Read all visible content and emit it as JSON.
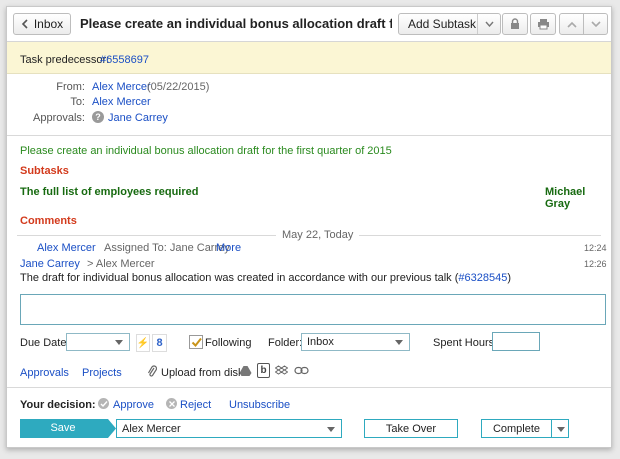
{
  "toolbar": {
    "back_label": "Inbox",
    "title": "Please create an individual bonus allocation draft for the fi",
    "add_subtask_label": "Add Subtask"
  },
  "predecessor": {
    "label": "Task predecessor:",
    "link": "#6558697"
  },
  "meta": {
    "from_label": "From:",
    "from_name": "Alex Mercer",
    "from_date": "(05/22/2015)",
    "to_label": "To:",
    "to_name": "Alex Mercer",
    "approvals_label": "Approvals:",
    "approvals_name": "Jane Carrey"
  },
  "description": "Please create an individual bonus allocation draft for the first quarter of 2015",
  "subtasks": {
    "heading": "Subtasks",
    "items": [
      {
        "name": "The full list of employees required",
        "assignee": "Michael Gray"
      }
    ]
  },
  "comments": {
    "heading": "Comments",
    "date_divider": "May 22, Today",
    "entries": [
      {
        "author": "Alex Mercer",
        "text": "Assigned To: Jane Carrey",
        "more": "More",
        "time": "12:24"
      },
      {
        "author": "Jane Carrey",
        "text": "> Alex Mercer",
        "time": "12:26",
        "body": "The draft for individual bonus allocation was created in accordance with our previous talk (",
        "body_link": "#6328545",
        "body_end": ")"
      }
    ]
  },
  "form": {
    "due_date_label": "Due Date:",
    "calendar_icon_text": "8",
    "following_label": "Following",
    "following_checked": true,
    "folder_label": "Folder:",
    "folder_value": "Inbox",
    "spent_hours_label": "Spent Hours:"
  },
  "links": {
    "approvals": "Approvals",
    "projects": "Projects",
    "upload": "Upload from disk",
    "upload_icon_b": "b"
  },
  "decision": {
    "label": "Your decision:",
    "approve": "Approve",
    "reject": "Reject",
    "unsubscribe": "Unsubscribe"
  },
  "actions": {
    "save": "Save",
    "assignee_value": "Alex Mercer",
    "take_over": "Take Over",
    "complete": "Complete"
  },
  "colors": {
    "save_button": "#2eaabf",
    "predecessor_bg": "#fbf6d4",
    "link": "#1a4fc5"
  }
}
